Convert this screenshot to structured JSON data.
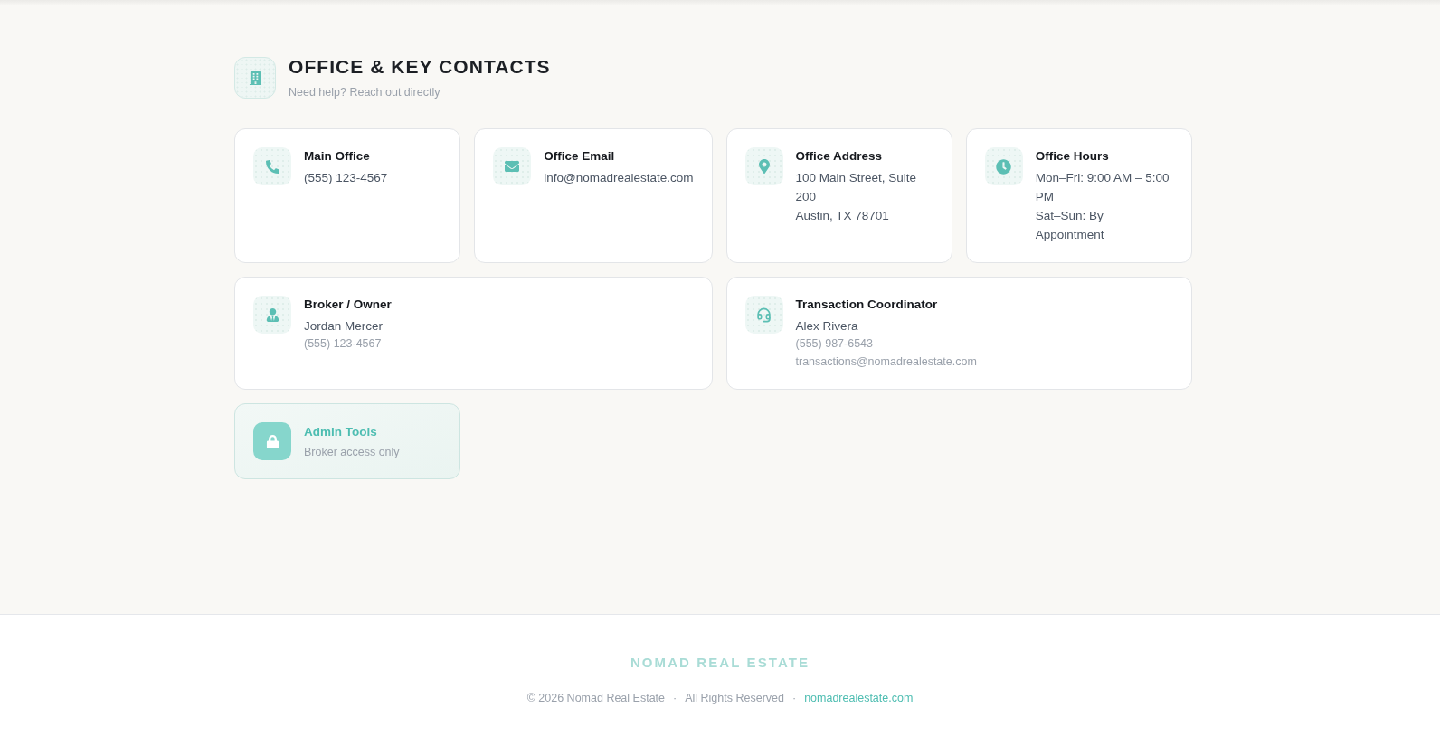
{
  "header": {
    "title": "OFFICE & KEY CONTACTS",
    "subtitle": "Need help? Reach out directly"
  },
  "info_cards": [
    {
      "title": "Main Office",
      "lines": [
        "(555) 123-4567"
      ]
    },
    {
      "title": "Office Email",
      "lines": [
        "info@nomadrealestate.com"
      ]
    },
    {
      "title": "Office Address",
      "lines": [
        "100 Main Street, Suite 200",
        "Austin, TX 78701"
      ]
    },
    {
      "title": "Office Hours",
      "lines": [
        "Mon–Fri: 9:00 AM – 5:00 PM",
        "Sat–Sun: By Appointment"
      ]
    }
  ],
  "contact_cards": [
    {
      "title": "Broker / Owner",
      "name": "Jordan Mercer",
      "details": [
        "(555) 123-4567"
      ]
    },
    {
      "title": "Transaction Coordinator",
      "name": "Alex Rivera",
      "details": [
        "(555) 987-6543",
        "transactions@nomadrealestate.com"
      ]
    }
  ],
  "admin_tools": {
    "title": "Admin Tools",
    "subtitle": "Broker access only"
  },
  "footer": {
    "brand": "NOMAD REAL ESTATE",
    "items": [
      {
        "kind": "text",
        "text": "© 2026 Nomad Real Estate"
      },
      {
        "kind": "separator",
        "text": "·"
      },
      {
        "kind": "text",
        "text": "All Rights Reserved"
      },
      {
        "kind": "separator",
        "text": "·"
      },
      {
        "kind": "link",
        "text": "nomadrealestate.com"
      }
    ]
  }
}
